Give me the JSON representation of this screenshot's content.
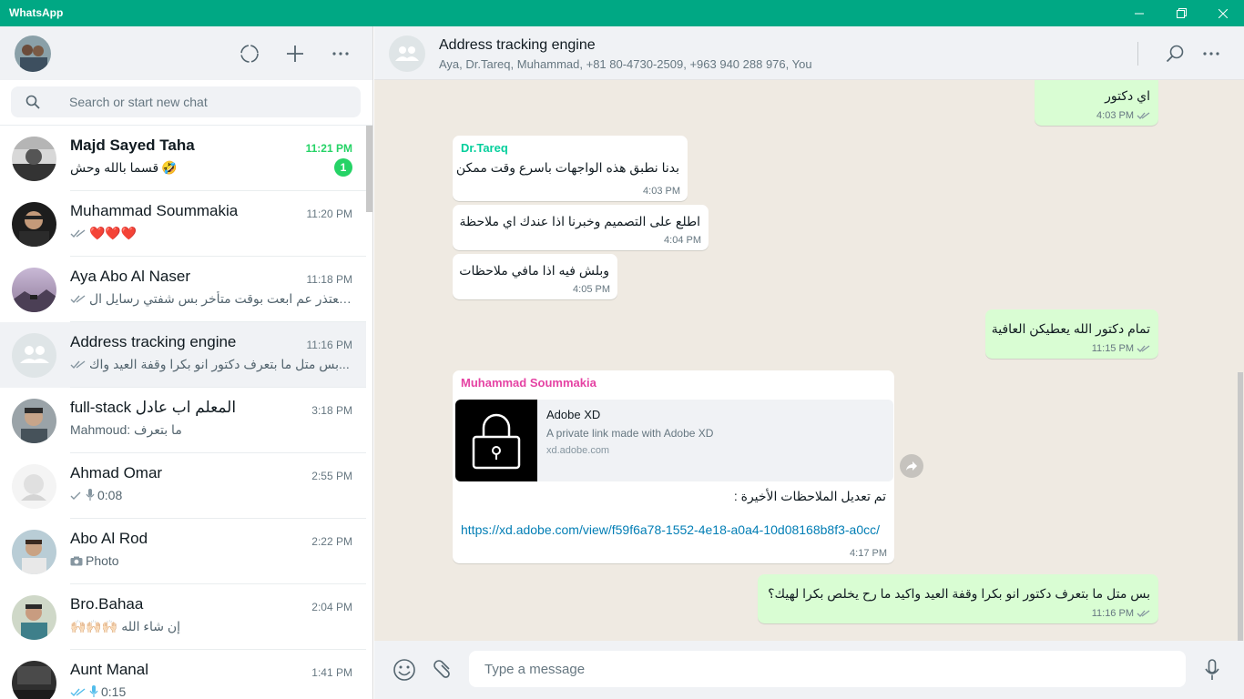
{
  "window": {
    "title": "WhatsApp",
    "controls": [
      "minimize",
      "maximize",
      "close"
    ]
  },
  "sidebar": {
    "search_placeholder": "Search or start new chat",
    "header_icons": [
      "status-icon",
      "new-chat-icon",
      "menu-icon"
    ],
    "chats": [
      {
        "name": "Majd Sayed Taha",
        "time": "11:21 PM",
        "preview": "قسما بالله وحش",
        "emoji": "🤣",
        "unread": "1",
        "bold": true
      },
      {
        "name": "Muhammad Soummakia",
        "time": "11:20 PM",
        "preview": "❤️❤️❤️",
        "ticks": "read"
      },
      {
        "name": "Aya Abo Al Naser",
        "time": "11:18 PM",
        "preview": "بعتذر عم ابعت بوقت متأخر بس شفتي رسايل ال...",
        "ticks": "read"
      },
      {
        "name": "Address tracking engine",
        "time": "11:16 PM",
        "preview": "بس متل ما بتعرف دكتور  انو بكرا وقفة العيد واك...",
        "ticks": "read",
        "active": true
      },
      {
        "name": "full-stack المعلم اب عادل",
        "time": "3:18 PM",
        "preview": "Mahmoud: ما بتعرف"
      },
      {
        "name": "Ahmad Omar",
        "time": "2:55 PM",
        "preview": "0:08",
        "ticks": "sent",
        "voice": true
      },
      {
        "name": "Abo Al Rod",
        "time": "2:22 PM",
        "preview": "Photo",
        "photo": true
      },
      {
        "name": "Bro.Bahaa",
        "time": "2:04 PM",
        "preview": "🙌🏻🙌🏻🙌🏻 إن شاء الله"
      },
      {
        "name": "Aunt Manal",
        "time": "1:41 PM",
        "preview": "0:15",
        "ticks": "read",
        "voice": true
      }
    ]
  },
  "conversation": {
    "title": "Address tracking engine",
    "participants": "Aya, Dr.Tareq, Muhammad, +81 80-4730-2509, +963 940 288 976, You",
    "messages": [
      {
        "dir": "out",
        "text": "اي دكتور",
        "time": "4:03 PM"
      },
      {
        "dir": "in",
        "sender": "Dr.Tareq",
        "text": "بدنا نطبق هذه الواجهات باسرع وقت ممكن",
        "time": "4:03 PM"
      },
      {
        "dir": "in",
        "text": "اطلع على التصميم وخبرنا اذا عندك اي ملاحظة",
        "time": "4:04 PM"
      },
      {
        "dir": "in",
        "text": "وبلش فيه اذا مافي ملاحظات",
        "time": "4:05 PM"
      },
      {
        "dir": "out",
        "text": "تمام دكتور الله يعطيكن العافية",
        "time": "11:15 PM"
      },
      {
        "dir": "in",
        "sender": "Muhammad Soummakia",
        "link_title": "Adobe XD",
        "link_desc": "A private link made with Adobe XD",
        "link_domain": "xd.adobe.com",
        "text": "تم تعديل الملاحظات الأخيرة :",
        "url": "https://xd.adobe.com/view/f59f6a78-1552-4e18-a0a4-10d08168b8f3-a0cc/",
        "time": "4:17 PM"
      },
      {
        "dir": "out",
        "text": "بس متل ما بتعرف دكتور  انو بكرا وقفة العيد واكيد ما رح يخلص بكرا لهيك؟",
        "time": "11:16 PM"
      }
    ]
  },
  "composer": {
    "placeholder": "Type a message"
  },
  "colors": {
    "brand": "#00a884",
    "unread": "#25d366",
    "out_bubble": "#d9fdd3",
    "in_bubble": "#ffffff",
    "chat_bg": "#efeae2",
    "sender_tareq": "#06cf9c",
    "sender_muhammad": "#e542a3",
    "read_tick": "#53bdeb",
    "link": "#027eb5"
  }
}
